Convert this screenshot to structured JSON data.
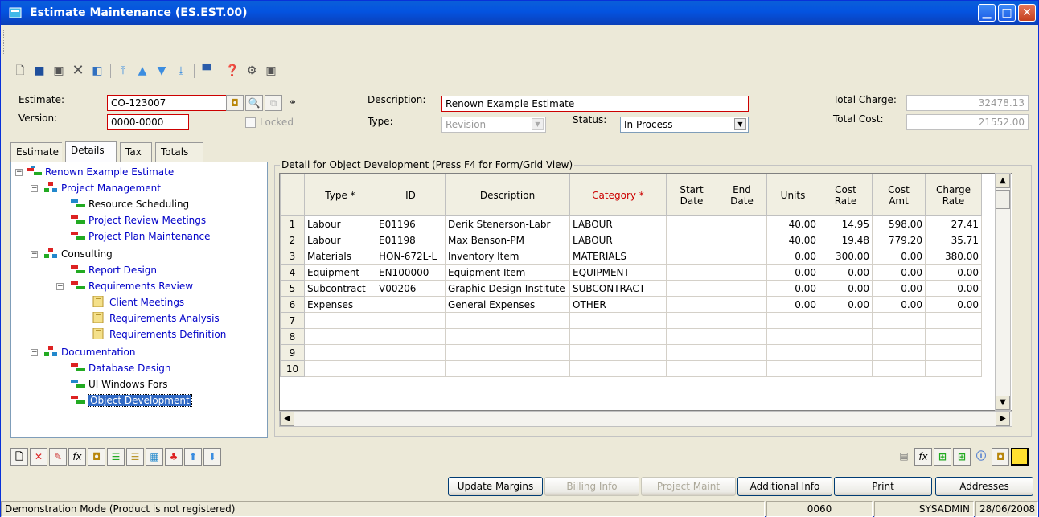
{
  "window": {
    "title": "Estimate Maintenance (ES.EST.00)"
  },
  "header": {
    "estimate_label": "Estimate:",
    "estimate_value": "CO-123007",
    "version_label": "Version:",
    "version_value": "0000-0000",
    "locked_label": "Locked",
    "description_label": "Description:",
    "description_value": "Renown Example Estimate",
    "type_label": "Type:",
    "type_value": "Revision",
    "status_label": "Status:",
    "status_value": "In Process",
    "total_charge_label": "Total Charge:",
    "total_charge_value": "32478.13",
    "total_cost_label": "Total Cost:",
    "total_cost_value": "21552.00"
  },
  "tabs": [
    {
      "label": "Estimate"
    },
    {
      "label": "Details"
    },
    {
      "label": "Tax"
    },
    {
      "label": "Totals"
    }
  ],
  "tree": {
    "nodes": [
      "Renown Example Estimate",
      "Project Management",
      "Resource Scheduling",
      "Project Review Meetings",
      "Project Plan Maintenance",
      "Consulting",
      "Report Design",
      "Requirements Review",
      "Client Meetings",
      "Requirements Analysis",
      "Requirements Definition",
      "Documentation",
      "Database Design",
      "UI Windows Fors",
      "Object Development"
    ]
  },
  "detail": {
    "legend": "Detail for Object Development (Press F4 for Form/Grid View)",
    "columns": [
      "Type *",
      "ID",
      "Description",
      "Category *",
      "Start Date",
      "End Date",
      "Units",
      "Cost Rate",
      "Cost Amt",
      "Charge Rate"
    ],
    "rows": [
      [
        "1",
        "Labour",
        "E01196",
        "Derik Stenerson-Labr",
        "LABOUR",
        "",
        "",
        "40.00",
        "14.95",
        "598.00",
        "27.41"
      ],
      [
        "2",
        "Labour",
        "E01198",
        "Max Benson-PM",
        "LABOUR",
        "",
        "",
        "40.00",
        "19.48",
        "779.20",
        "35.71"
      ],
      [
        "3",
        "Materials",
        "HON-672L-L",
        "Inventory Item",
        "MATERIALS",
        "",
        "",
        "0.00",
        "300.00",
        "0.00",
        "380.00"
      ],
      [
        "4",
        "Equipment",
        "EN100000",
        "Equipment Item",
        "EQUIPMENT",
        "",
        "",
        "0.00",
        "0.00",
        "0.00",
        "0.00"
      ],
      [
        "5",
        "Subcontract",
        "V00206",
        "Graphic Design Institute",
        "SUBCONTRACT",
        "",
        "",
        "0.00",
        "0.00",
        "0.00",
        "0.00"
      ],
      [
        "6",
        "Expenses",
        "",
        "General Expenses",
        "OTHER",
        "",
        "",
        "0.00",
        "0.00",
        "0.00",
        "0.00"
      ],
      [
        "7",
        "",
        "",
        "",
        "",
        "",
        "",
        "",
        "",
        "",
        ""
      ],
      [
        "8",
        "",
        "",
        "",
        "",
        "",
        "",
        "",
        "",
        "",
        ""
      ],
      [
        "9",
        "",
        "",
        "",
        "",
        "",
        "",
        "",
        "",
        "",
        ""
      ],
      [
        "10",
        "",
        "",
        "",
        "",
        "",
        "",
        "",
        "",
        "",
        ""
      ]
    ]
  },
  "actions": {
    "update_margins": "Update Margins",
    "billing_info": "Billing Info",
    "project_maint": "Project Maint",
    "additional_info": "Additional Info",
    "print": "Print",
    "addresses": "Addresses"
  },
  "statusbar": {
    "message": "Demonstration Mode (Product is not registered)",
    "code": "0060",
    "user": "SYSADMIN",
    "date": "28/06/2008"
  },
  "colors": {
    "title_blue": "#0a5fd9",
    "required_red": "#cc0000",
    "link_blue": "#0000c8",
    "selection": "#316ac5"
  }
}
